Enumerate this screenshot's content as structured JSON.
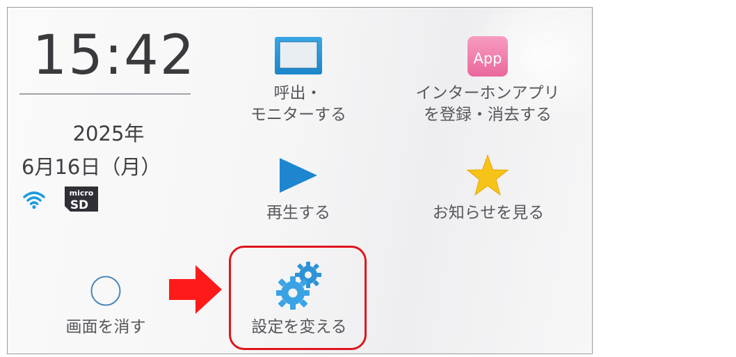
{
  "status": {
    "time": "15:42",
    "year": "2025年",
    "date": "6月16日（月）",
    "wifi_icon": "wifi-icon",
    "sd_icon": "microsd-icon",
    "sd_text_top": "micro",
    "sd_text_bottom": "SD"
  },
  "menu": {
    "monitor": {
      "label_line1": "呼出・",
      "label_line2": "モニターする",
      "icon": "monitor-icon"
    },
    "app": {
      "label_line1": "インターホンアプリ",
      "label_line2": "を登録・消去する",
      "icon": "app-icon",
      "icon_text": "App"
    },
    "play": {
      "label": "再生する",
      "icon": "play-icon"
    },
    "news": {
      "label": "お知らせを見る",
      "icon": "star-icon"
    },
    "screen_off": {
      "label": "画面を消す",
      "icon": "circle-icon"
    },
    "settings": {
      "label": "設定を変える",
      "icon": "gear-icon"
    }
  },
  "annotation": {
    "highlight_color": "#e0141c",
    "arrow_color": "#ff1a1a"
  }
}
